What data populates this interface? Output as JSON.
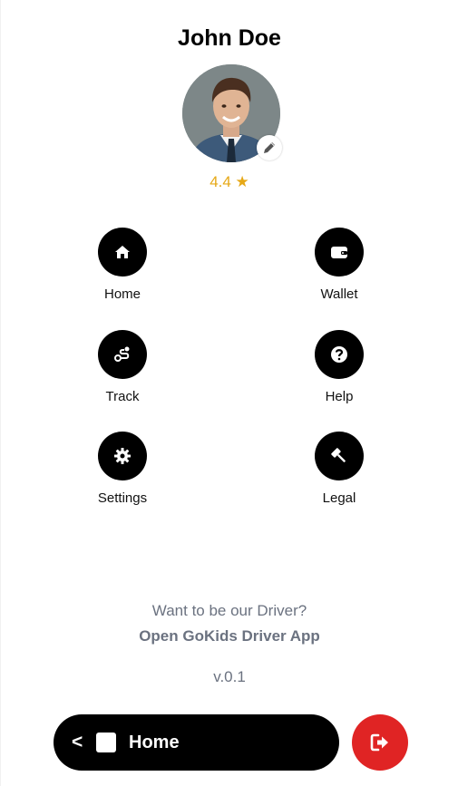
{
  "profile": {
    "name": "John Doe",
    "rating": "4.4 ★"
  },
  "menu": {
    "items": [
      {
        "label": "Home",
        "icon": "home-icon"
      },
      {
        "label": "Wallet",
        "icon": "wallet-icon"
      },
      {
        "label": "Track",
        "icon": "route-icon"
      },
      {
        "label": "Help",
        "icon": "help-icon"
      },
      {
        "label": "Settings",
        "icon": "gear-icon"
      },
      {
        "label": "Legal",
        "icon": "gavel-icon"
      }
    ]
  },
  "promo": {
    "question": "Want to be our Driver?",
    "link": "Open GoKids Driver App"
  },
  "version": "v.0.1",
  "bottom_bar": {
    "back": "<",
    "title": "Home"
  },
  "colors": {
    "accent_rating": "#e6a817",
    "logout": "#e02424",
    "muted_text": "#6b7280"
  }
}
